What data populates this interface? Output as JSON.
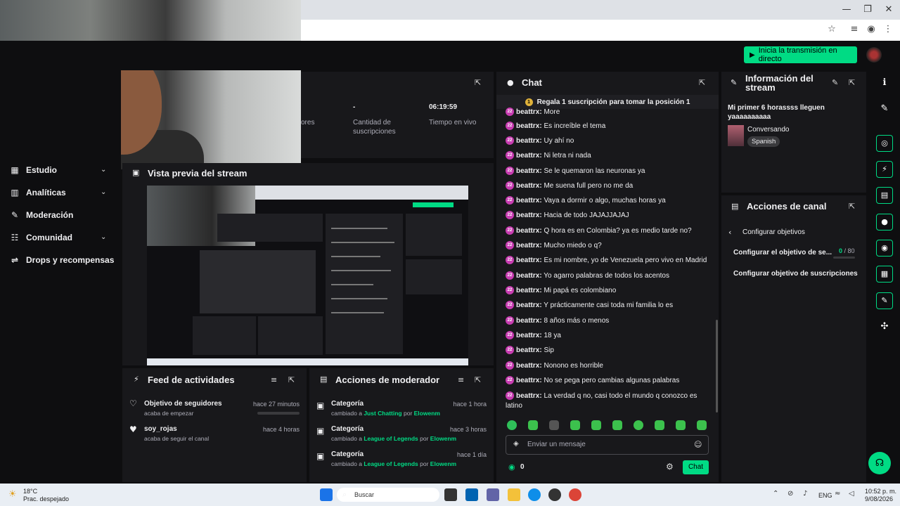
{
  "browser": {
    "window_controls": [
      "—",
      "❐",
      "✕"
    ],
    "address_icons": [
      "star-icon",
      "media-icon",
      "account-icon",
      "menu-icon"
    ]
  },
  "header": {
    "go_live_label": "Inicia la transmisión en directo"
  },
  "sidebar": {
    "items": [
      {
        "label": "Estudio",
        "icon": "studio-icon",
        "chevron": true
      },
      {
        "label": "Analíticas",
        "icon": "analytics-icon",
        "chevron": true
      },
      {
        "label": "Moderación",
        "icon": "wrench-icon",
        "chevron": false
      },
      {
        "label": "Comunidad",
        "icon": "people-icon",
        "chevron": true
      },
      {
        "label": "Drops y recompensas",
        "icon": "drops-icon",
        "chevron": false
      }
    ]
  },
  "stats": {
    "items": [
      {
        "label": "ores",
        "value": ""
      },
      {
        "label": "Cantidad de suscripciones",
        "value": "-"
      },
      {
        "label": "Tiempo en vivo",
        "value": "06:19:59"
      }
    ]
  },
  "preview": {
    "title": "Vista previa del stream"
  },
  "activity_feed": {
    "title": "Feed de actividades",
    "items": [
      {
        "title": "Objetivo de seguidores",
        "subtitle": "acaba de empezar",
        "time": "hace 27 minutos",
        "progress": 0.0
      },
      {
        "title": "soy_rojas",
        "subtitle": "acaba de seguir el canal",
        "time": "hace 4 horas"
      }
    ]
  },
  "mod_actions": {
    "title": "Acciones de moderador",
    "items": [
      {
        "title": "Categoría",
        "prefix": "cambiado a ",
        "category": "Just Chatting",
        "by": " por ",
        "user": "Elowenm",
        "time": "hace 1 hora"
      },
      {
        "title": "Categoría",
        "prefix": "cambiado a ",
        "category": "League of Legends",
        "by": " por ",
        "user": "Elowenm",
        "time": "hace 3 horas"
      },
      {
        "title": "Categoría",
        "prefix": "cambiado a ",
        "category": "League of Legends",
        "by": " por ",
        "user": "Elowenm",
        "time": "hace 1 día"
      }
    ]
  },
  "chat": {
    "title": "Chat",
    "pinned": "Regala 1 suscripción para tomar la posición 1",
    "badge_text": "22",
    "messages": [
      {
        "user": "beattrx:",
        "text": "More"
      },
      {
        "user": "beattrx:",
        "text": "Es increíble el tema"
      },
      {
        "user": "beattrx:",
        "text": "Uy ahí no"
      },
      {
        "user": "beattrx:",
        "text": "Ni letra ni nada"
      },
      {
        "user": "beattrx:",
        "text": "Se le quemaron las neuronas ya"
      },
      {
        "user": "beattrx:",
        "text": "Me suena full pero no me da"
      },
      {
        "user": "beattrx:",
        "text": "Vaya a dormir o algo, muchas horas ya"
      },
      {
        "user": "beattrx:",
        "text": "Hacia de todo JAJAJJAJAJ"
      },
      {
        "user": "beattrx:",
        "text": "Q hora es en Colombia? ya es medio tarde no?"
      },
      {
        "user": "beattrx:",
        "text": "Mucho miedo o q?"
      },
      {
        "user": "beattrx:",
        "text": "Es mi nombre, yo de Venezuela pero vivo en Madrid"
      },
      {
        "user": "beattrx:",
        "text": "Yo agarro palabras de todos los acentos"
      },
      {
        "user": "beattrx:",
        "text": "Mi papá es colombiano"
      },
      {
        "user": "beattrx:",
        "text": "Y prácticamente casi toda mi familia lo es"
      },
      {
        "user": "beattrx:",
        "text": "8 años más o menos"
      },
      {
        "user": "beattrx:",
        "text": "18 ya"
      },
      {
        "user": "beattrx:",
        "text": "Sip"
      },
      {
        "user": "beattrx:",
        "text": "Nonono es horrible"
      },
      {
        "user": "beattrx:",
        "text": "No se pega pero cambias algunas palabras"
      },
      {
        "user": "beattrx:",
        "text": "La verdad q no, casi todo el mundo q conozco es latino"
      }
    ],
    "input_placeholder": "Enviar un mensaje",
    "points": "0",
    "send_label": "Chat"
  },
  "stream_info": {
    "title": "Información del stream",
    "stream_title": "Mi primer 6 horassss lleguen yaaaaaaaaaa",
    "category": "Conversando",
    "tag": "Spanish"
  },
  "channel_actions": {
    "title": "Acciones de canal",
    "back_label": "Configurar objetivos",
    "items": [
      {
        "label": "Configurar el objetivo de se...",
        "current": "0",
        "target": " / 80"
      },
      {
        "label": "Configurar objetivo de suscripciones"
      }
    ]
  },
  "taskbar": {
    "weather_temp": "18°C",
    "weather_desc": "Prac. despejado",
    "search_placeholder": "Buscar",
    "lang": "ENG",
    "time": "10:52 p. m.",
    "date": "9/08/2026"
  },
  "colors": {
    "accent": "#00db84",
    "background": "#0e0e10",
    "panel": "#18181b",
    "badge": "#c83db1"
  }
}
